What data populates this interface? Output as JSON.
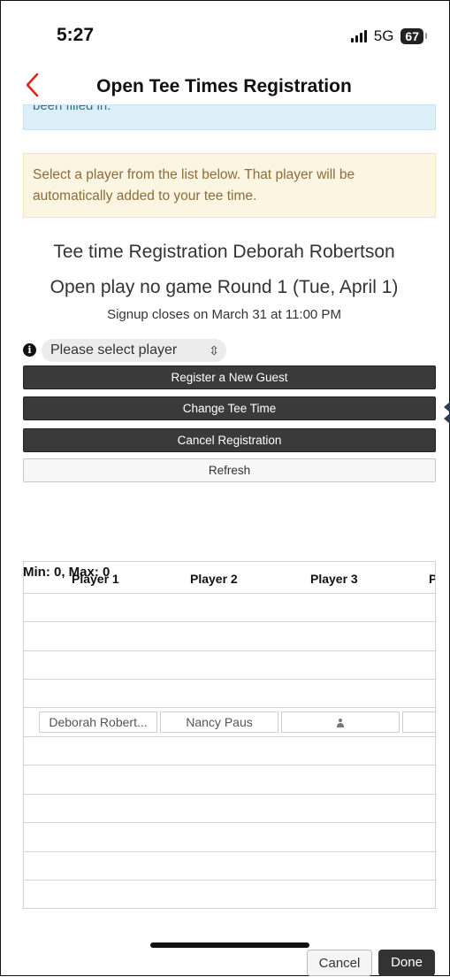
{
  "status_bar": {
    "time": "5:27",
    "network": "5G",
    "battery": "67"
  },
  "nav": {
    "title": "Open Tee Times Registration"
  },
  "banners": {
    "info_partial": "been filled in.",
    "instruction": "Select a player from the list below. That player will be automatically added to your tee time."
  },
  "registration": {
    "title": "Tee time Registration Deborah Robertson",
    "round": "Open play no game Round 1 (Tue, April 1)",
    "signup": "Signup closes on March 31 at 11:00 PM"
  },
  "player_select": {
    "selected": "Please select player"
  },
  "buttons": {
    "register_guest": "Register a New Guest",
    "change_tee_time": "Change Tee Time",
    "cancel_registration": "Cancel Registration",
    "refresh": "Refresh"
  },
  "table": {
    "minmax": "Min: 0, Max: 0",
    "headers": [
      "Player 1",
      "Player 2",
      "Player 3",
      "P"
    ],
    "filled_row": [
      "Deborah Robert...",
      "Nancy Paus",
      "",
      ""
    ]
  },
  "footer": {
    "cancel": "Cancel",
    "done": "Done"
  }
}
